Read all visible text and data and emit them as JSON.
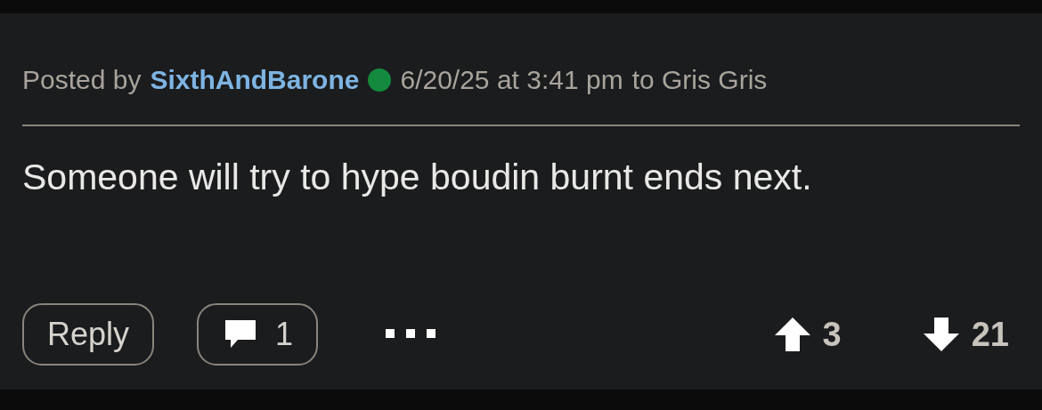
{
  "post": {
    "prefix": "Posted by",
    "author": "SixthAndBarone",
    "online": true,
    "timestamp": "6/20/25 at 3:41 pm",
    "recipient": "to Gris Gris",
    "body": "Someone will try to hype boudin burnt ends next.",
    "reply_label": "Reply",
    "comment_count": "1",
    "upvotes": "3",
    "downvotes": "21"
  }
}
